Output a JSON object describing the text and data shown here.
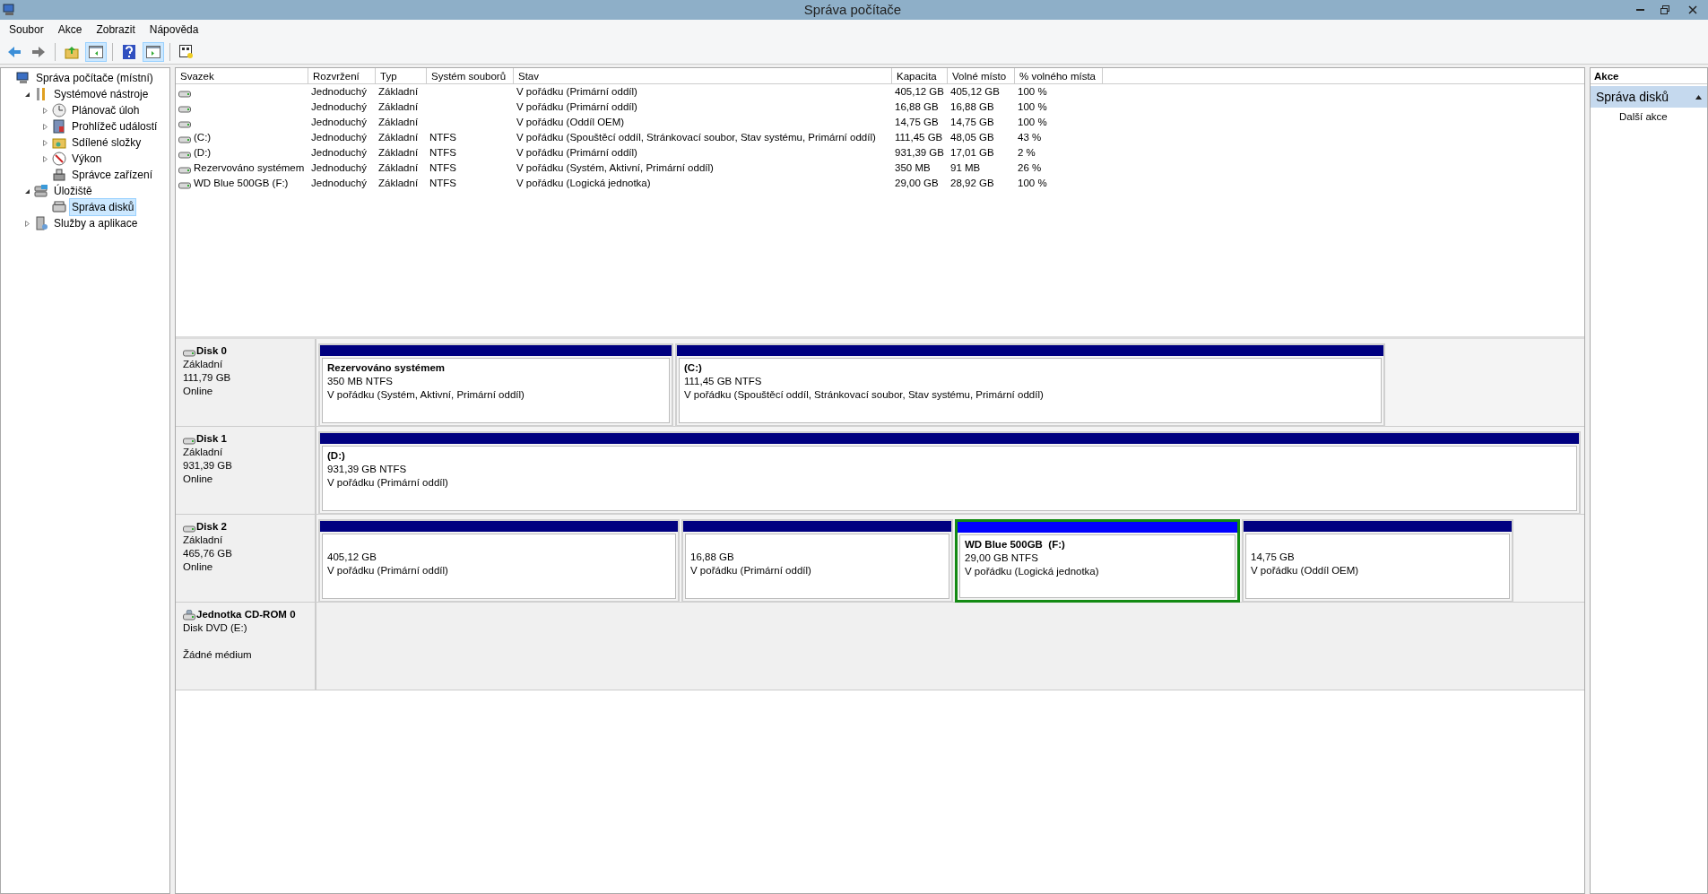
{
  "window": {
    "title": "Správa počítače"
  },
  "menu": [
    "Soubor",
    "Akce",
    "Zobrazit",
    "Nápověda"
  ],
  "toolbar": [
    {
      "kind": "back",
      "pressed": false
    },
    {
      "kind": "forward",
      "pressed": false
    },
    {
      "kind": "sep"
    },
    {
      "kind": "up",
      "pressed": false
    },
    {
      "kind": "tree",
      "pressed": true
    },
    {
      "kind": "sep"
    },
    {
      "kind": "help",
      "pressed": false
    },
    {
      "kind": "pane",
      "pressed": true
    },
    {
      "kind": "sep"
    },
    {
      "kind": "props",
      "pressed": false
    }
  ],
  "tree": [
    {
      "label": "Správa počítače (místní)",
      "selected": false,
      "children": [
        {
          "label": "Systémové nástroje",
          "expanded": true,
          "selected": false,
          "children": [
            {
              "label": "Plánovač úloh",
              "expanded": false,
              "selected": false
            },
            {
              "label": "Prohlížeč událostí",
              "expanded": false,
              "selected": false
            },
            {
              "label": "Sdílené složky",
              "expanded": false,
              "selected": false
            },
            {
              "label": "Výkon",
              "expanded": false,
              "selected": false
            },
            {
              "label": "Správce zařízení",
              "selected": false
            }
          ]
        },
        {
          "label": "Úložiště",
          "expanded": true,
          "selected": false,
          "children": [
            {
              "label": "Správa disků",
              "selected": true
            }
          ]
        },
        {
          "label": "Služby a aplikace",
          "expanded": false,
          "selected": false
        }
      ]
    }
  ],
  "table": {
    "columns": [
      "Svazek",
      "Rozvržení",
      "Typ",
      "Systém souborů",
      "Stav",
      "Kapacita",
      "Volné místo",
      "% volného místa"
    ],
    "rows": [
      [
        "",
        "Jednoduchý",
        "Základní",
        "",
        "V pořádku (Primární oddíl)",
        "405,12 GB",
        "405,12 GB",
        "100 %"
      ],
      [
        "",
        "Jednoduchý",
        "Základní",
        "",
        "V pořádku (Primární oddíl)",
        "16,88 GB",
        "16,88 GB",
        "100 %"
      ],
      [
        "",
        "Jednoduchý",
        "Základní",
        "",
        "V pořádku (Oddíl OEM)",
        "14,75 GB",
        "14,75 GB",
        "100 %"
      ],
      [
        "(C:)",
        "Jednoduchý",
        "Základní",
        "NTFS",
        "V pořádku (Spouštěcí oddíl, Stránkovací soubor, Stav systému, Primární oddíl)",
        "111,45 GB",
        "48,05 GB",
        "43 %"
      ],
      [
        "(D:)",
        "Jednoduchý",
        "Základní",
        "NTFS",
        "V pořádku (Primární oddíl)",
        "931,39 GB",
        "17,01 GB",
        "2 %"
      ],
      [
        "Rezervováno systémem",
        "Jednoduchý",
        "Základní",
        "NTFS",
        "V pořádku (Systém, Aktivní, Primární oddíl)",
        "350 MB",
        "91 MB",
        "26 %"
      ],
      [
        "WD Blue 500GB (F:)",
        "Jednoduchý",
        "Základní",
        "NTFS",
        "V pořádku (Logická jednotka)",
        "29,00 GB",
        "28,92 GB",
        "100 %"
      ]
    ]
  },
  "disks": [
    {
      "kind": "disk",
      "name": "Disk 0",
      "lines": [
        "Základní",
        "111,79 GB",
        "Online"
      ],
      "partitions": [
        {
          "name": "Rezervováno systémem",
          "size": "350 MB NTFS",
          "status": "V pořádku (Systém, Aktivní, Primární oddíl)",
          "selected": false
        },
        {
          "name": "(C:)",
          "size": "111,45 GB NTFS",
          "status": "V pořádku (Spouštěcí oddíl, Stránkovací soubor, Stav systému, Primární oddíl)",
          "selected": false
        }
      ]
    },
    {
      "kind": "disk",
      "name": "Disk 1",
      "lines": [
        "Základní",
        "931,39 GB",
        "Online"
      ],
      "partitions": [
        {
          "name": "(D:)",
          "size": "931,39 GB NTFS",
          "status": "V pořádku (Primární oddíl)",
          "selected": false
        }
      ]
    },
    {
      "kind": "disk",
      "name": "Disk 2",
      "lines": [
        "Základní",
        "465,76 GB",
        "Online"
      ],
      "partitions": [
        {
          "size": "405,12 GB",
          "status": "V pořádku (Primární oddíl)",
          "selected": false
        },
        {
          "size": "16,88 GB",
          "status": "V pořádku (Primární oddíl)",
          "selected": false
        },
        {
          "name": "WD Blue 500GB  (F:)",
          "size": "29,00 GB NTFS",
          "status": "V pořádku (Logická jednotka)",
          "selected": true
        },
        {
          "size": "14,75 GB",
          "status": "V pořádku (Oddíl OEM)",
          "selected": false
        }
      ]
    },
    {
      "kind": "cdrom",
      "name": "Jednotka CD-ROM 0",
      "lines": [
        "Disk DVD (E:)",
        "Žádné médium"
      ]
    }
  ],
  "actions": {
    "title": "Akce",
    "section": "Správa disků",
    "items": [
      "Další akce"
    ]
  }
}
